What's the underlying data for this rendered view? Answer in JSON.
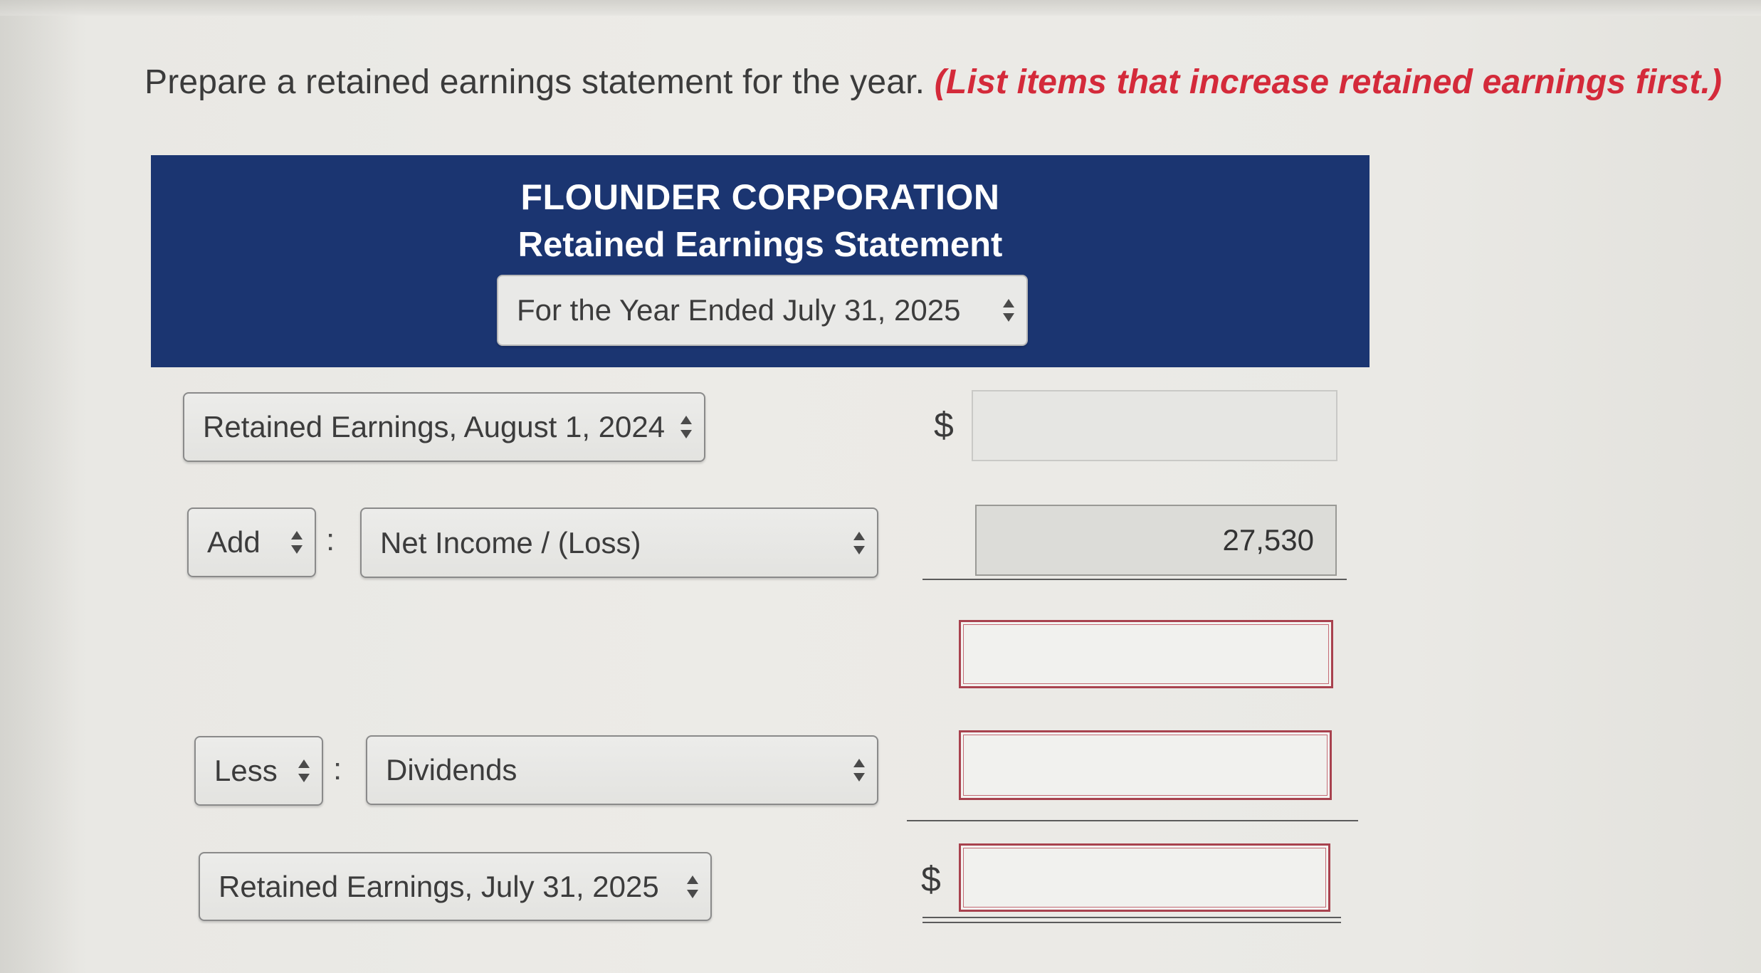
{
  "instruction": {
    "text": "Prepare a retained earnings statement for the year.",
    "note": "(List items that increase retained earnings first.)"
  },
  "header": {
    "company": "FLOUNDER CORPORATION",
    "title": "Retained Earnings Statement",
    "period_select": "For the Year Ended July 31, 2025"
  },
  "rows": {
    "beginning": {
      "label_select": "Retained Earnings, August 1, 2024",
      "currency": "$",
      "amount": ""
    },
    "add": {
      "operator_select": "Add",
      "separator": ":",
      "item_select": "Net Income / (Loss)",
      "amount": "27,530"
    },
    "subtotal": {
      "amount": ""
    },
    "less": {
      "operator_select": "Less",
      "separator": ":",
      "item_select": "Dividends",
      "amount": ""
    },
    "ending": {
      "label_select": "Retained Earnings, July 31, 2025",
      "currency": "$",
      "amount": ""
    }
  },
  "colors": {
    "header_band": "#1b3571",
    "note_red": "#d42a3a",
    "error_border": "#a8424e"
  }
}
